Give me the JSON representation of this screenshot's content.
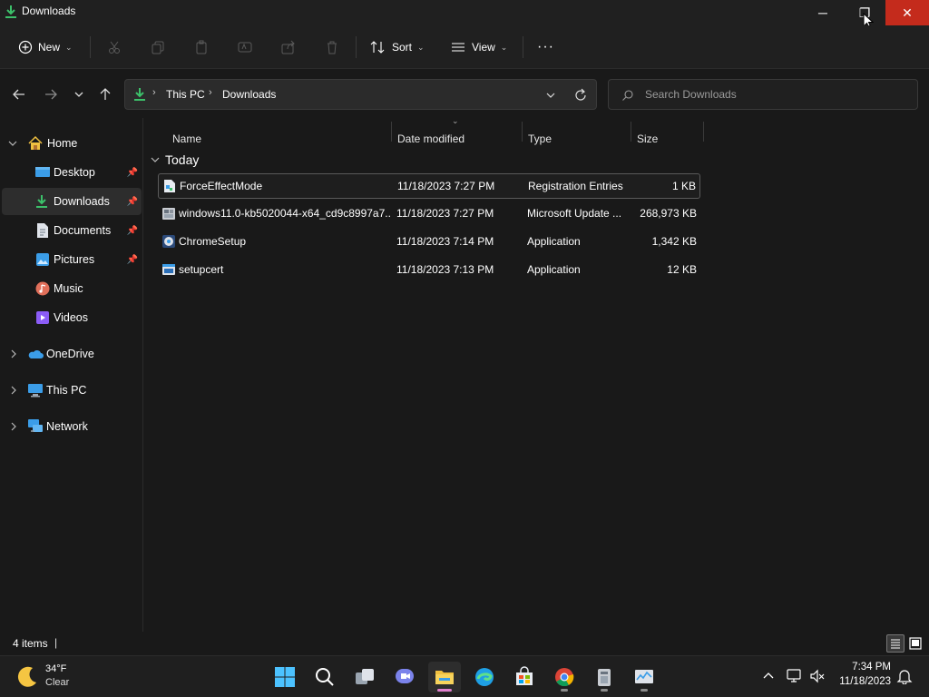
{
  "window": {
    "title": "Downloads",
    "min_glyph": "─",
    "max_glyph": "❐",
    "close_glyph": "✕"
  },
  "toolbar": {
    "new_label": "New",
    "sort_label": "Sort",
    "view_label": "View",
    "more_label": "···"
  },
  "address": {
    "crumbs": [
      "This PC",
      "Downloads"
    ],
    "search_placeholder": "Search Downloads"
  },
  "sidebar": {
    "items": [
      {
        "label": "Home"
      },
      {
        "label": "Desktop"
      },
      {
        "label": "Downloads"
      },
      {
        "label": "Documents"
      },
      {
        "label": "Pictures"
      },
      {
        "label": "Music"
      },
      {
        "label": "Videos"
      },
      {
        "label": "OneDrive"
      },
      {
        "label": "This PC"
      },
      {
        "label": "Network"
      }
    ]
  },
  "columns": {
    "name": "Name",
    "date": "Date modified",
    "type": "Type",
    "size": "Size"
  },
  "group": {
    "label": "Today"
  },
  "files": [
    {
      "name": "ForceEffectMode",
      "date": "11/18/2023 7:27 PM",
      "type": "Registration Entries",
      "size": "1 KB",
      "icon": "registry-file-icon"
    },
    {
      "name": "windows11.0-kb5020044-x64_cd9c8997a7...",
      "date": "11/18/2023 7:27 PM",
      "type": "Microsoft Update ...",
      "size": "268,973 KB",
      "icon": "update-package-icon"
    },
    {
      "name": "ChromeSetup",
      "date": "11/18/2023 7:14 PM",
      "type": "Application",
      "size": "1,342 KB",
      "icon": "installer-icon"
    },
    {
      "name": "setupcert",
      "date": "11/18/2023 7:13 PM",
      "type": "Application",
      "size": "12 KB",
      "icon": "application-icon"
    }
  ],
  "status": {
    "items": "4 items",
    "cursor": "|"
  },
  "taskbar": {
    "weather_temp": "34°F",
    "weather_desc": "Clear",
    "time": "7:34 PM",
    "date": "11/18/2023"
  },
  "colors": {
    "accent_green": "#2ea043",
    "close_red": "#c42b1c",
    "folder_yellow": "#f0c040",
    "taskbar_active": "#e07fce"
  }
}
